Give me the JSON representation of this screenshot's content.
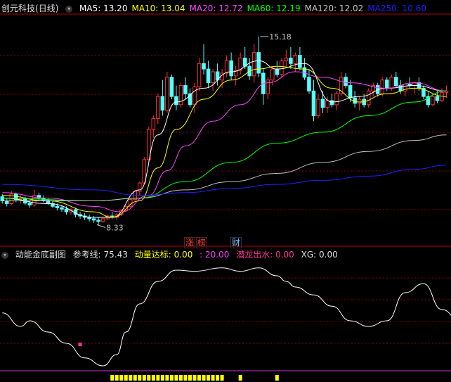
{
  "top_header": {
    "stock_name": "创元科技",
    "period": "(日线)",
    "ma_items": [
      {
        "label": "MA5:",
        "value": "13.20",
        "color": "#ffffff"
      },
      {
        "label": "MA10:",
        "value": "13.04",
        "color": "#ffff00"
      },
      {
        "label": "MA20:",
        "value": "12.72",
        "color": "#ff44ff"
      },
      {
        "label": "MA60:",
        "value": "12.19",
        "color": "#00ff00"
      },
      {
        "label": "MA120:",
        "value": "12.02",
        "color": "#c0c0c0"
      },
      {
        "label": "MA250:",
        "value": "10.60",
        "color": "#2020ff"
      }
    ]
  },
  "price_annotations": {
    "high": "15.18",
    "low": "8.33"
  },
  "event_tags": [
    "涨",
    "榜",
    "财"
  ],
  "bottom_header": {
    "indicator_name": "动能金底副图",
    "ref_label": "参考线:",
    "ref_value": "75.43",
    "signal_label": "动量达标:",
    "signal_value": "0.00",
    "signal_value2": ": 20.00",
    "dragon_label": "潜龙出水:",
    "dragon_value": "0.00",
    "xg_label": "XG:",
    "xg_value": "0.00"
  },
  "colors": {
    "up": "#ff3232",
    "down": "#54ffff",
    "grid": "#8b0000",
    "axis": "#b40000"
  },
  "chart_data": [
    {
      "type": "candlestick",
      "title": "创元科技 (日线)",
      "ylim": [
        7.6,
        16.0
      ],
      "candles": [
        [
          9.35,
          9.45,
          9.1,
          9.2
        ],
        [
          9.2,
          9.3,
          9.0,
          9.1
        ],
        [
          9.1,
          9.55,
          9.05,
          9.45
        ],
        [
          9.45,
          9.5,
          9.15,
          9.25
        ],
        [
          9.25,
          9.4,
          9.1,
          9.3
        ],
        [
          9.3,
          9.35,
          9.05,
          9.12
        ],
        [
          9.12,
          9.2,
          8.95,
          9.05
        ],
        [
          9.05,
          9.6,
          9.0,
          9.4
        ],
        [
          9.4,
          9.5,
          9.2,
          9.3
        ],
        [
          9.3,
          9.4,
          9.15,
          9.22
        ],
        [
          9.22,
          9.3,
          9.05,
          9.1
        ],
        [
          9.1,
          9.2,
          8.95,
          9.0
        ],
        [
          9.0,
          9.1,
          8.85,
          8.95
        ],
        [
          8.95,
          9.05,
          8.8,
          8.9
        ],
        [
          8.9,
          9.0,
          8.7,
          8.8
        ],
        [
          8.8,
          8.95,
          8.7,
          8.88
        ],
        [
          8.88,
          8.95,
          8.6,
          8.7
        ],
        [
          8.7,
          8.8,
          8.55,
          8.65
        ],
        [
          8.65,
          8.75,
          8.5,
          8.6
        ],
        [
          8.6,
          8.7,
          8.45,
          8.55
        ],
        [
          8.55,
          8.65,
          8.4,
          8.5
        ],
        [
          8.5,
          8.6,
          8.33,
          8.45
        ],
        [
          8.45,
          8.6,
          8.4,
          8.55
        ],
        [
          8.55,
          8.7,
          8.5,
          8.65
        ],
        [
          8.65,
          8.8,
          8.55,
          8.6
        ],
        [
          8.6,
          8.75,
          8.5,
          8.7
        ],
        [
          8.7,
          8.9,
          8.65,
          8.85
        ],
        [
          8.85,
          9.05,
          8.8,
          9.0
        ],
        [
          9.0,
          9.3,
          8.95,
          9.25
        ],
        [
          9.25,
          9.6,
          9.2,
          9.55
        ],
        [
          9.55,
          9.9,
          9.4,
          9.85
        ],
        [
          9.85,
          10.8,
          9.8,
          10.7
        ],
        [
          10.7,
          11.9,
          10.6,
          11.8
        ],
        [
          11.8,
          12.3,
          11.5,
          12.2
        ],
        [
          12.2,
          13.1,
          12.0,
          13.0
        ],
        [
          13.0,
          13.6,
          12.3,
          12.5
        ],
        [
          12.5,
          13.9,
          12.4,
          13.7
        ],
        [
          13.7,
          13.8,
          12.9,
          13.0
        ],
        [
          13.0,
          13.4,
          12.5,
          12.7
        ],
        [
          12.7,
          13.5,
          12.6,
          13.4
        ],
        [
          13.4,
          13.7,
          12.9,
          13.1
        ],
        [
          13.1,
          13.3,
          12.6,
          12.7
        ],
        [
          12.7,
          13.5,
          12.4,
          13.35
        ],
        [
          13.35,
          14.4,
          13.2,
          14.2
        ],
        [
          14.2,
          14.9,
          13.8,
          14.0
        ],
        [
          14.0,
          14.3,
          13.3,
          13.5
        ],
        [
          13.5,
          14.0,
          13.2,
          13.9
        ],
        [
          13.9,
          14.2,
          13.4,
          13.6
        ],
        [
          13.6,
          14.0,
          13.3,
          13.85
        ],
        [
          13.85,
          14.5,
          13.7,
          14.3
        ],
        [
          14.3,
          14.6,
          13.6,
          13.75
        ],
        [
          13.75,
          14.1,
          13.4,
          13.95
        ],
        [
          13.95,
          14.6,
          13.8,
          14.4
        ],
        [
          14.4,
          14.8,
          14.0,
          14.1
        ],
        [
          14.1,
          14.4,
          13.6,
          13.75
        ],
        [
          13.75,
          14.9,
          13.5,
          14.6
        ],
        [
          14.6,
          15.18,
          13.7,
          13.85
        ],
        [
          13.85,
          14.0,
          12.7,
          13.1
        ],
        [
          13.1,
          13.7,
          12.9,
          13.6
        ],
        [
          13.6,
          14.1,
          13.4,
          14.0
        ],
        [
          14.0,
          14.3,
          13.7,
          13.8
        ],
        [
          13.8,
          14.4,
          13.7,
          14.3
        ],
        [
          14.3,
          14.7,
          14.1,
          14.4
        ],
        [
          14.4,
          14.8,
          14.0,
          14.2
        ],
        [
          14.2,
          14.6,
          13.9,
          14.5
        ],
        [
          14.5,
          14.8,
          13.95,
          14.05
        ],
        [
          14.05,
          14.4,
          13.6,
          13.7
        ],
        [
          13.7,
          14.0,
          13.1,
          13.2
        ],
        [
          13.2,
          13.6,
          12.1,
          12.3
        ],
        [
          12.3,
          13.1,
          12.2,
          12.9
        ],
        [
          12.9,
          13.2,
          12.4,
          12.6
        ],
        [
          12.6,
          13.0,
          12.4,
          12.85
        ],
        [
          12.85,
          13.1,
          12.6,
          12.7
        ],
        [
          12.7,
          13.2,
          12.5,
          13.1
        ],
        [
          13.1,
          13.9,
          13.0,
          13.7
        ],
        [
          13.7,
          13.85,
          13.3,
          13.4
        ],
        [
          13.4,
          13.6,
          12.8,
          12.95
        ],
        [
          12.95,
          13.2,
          12.6,
          12.75
        ],
        [
          12.75,
          13.0,
          12.5,
          12.9
        ],
        [
          12.9,
          13.1,
          12.6,
          12.7
        ],
        [
          12.7,
          13.3,
          12.6,
          13.2
        ],
        [
          13.2,
          13.5,
          13.0,
          13.4
        ],
        [
          13.4,
          13.5,
          13.0,
          13.1
        ],
        [
          13.1,
          13.7,
          13.0,
          13.6
        ],
        [
          13.6,
          13.7,
          13.2,
          13.3
        ],
        [
          13.3,
          13.8,
          13.2,
          13.7
        ],
        [
          13.7,
          13.9,
          13.3,
          13.4
        ],
        [
          13.4,
          13.6,
          13.1,
          13.2
        ],
        [
          13.2,
          13.5,
          13.0,
          13.45
        ],
        [
          13.45,
          13.7,
          13.3,
          13.4
        ],
        [
          13.4,
          13.55,
          13.1,
          13.5
        ],
        [
          13.5,
          13.7,
          13.2,
          13.3
        ],
        [
          13.3,
          13.4,
          12.9,
          13.0
        ],
        [
          13.0,
          13.2,
          12.6,
          12.7
        ],
        [
          12.7,
          13.1,
          12.65,
          13.0
        ],
        [
          13.0,
          13.2,
          12.75,
          12.85
        ],
        [
          12.85,
          13.3,
          12.8,
          13.15
        ],
        [
          13.15,
          13.4,
          12.95,
          13.2
        ]
      ],
      "ma_series": [
        {
          "name": "MA5",
          "color": "#ffffff",
          "x": [
            0,
            10,
            20,
            24,
            30,
            34,
            38,
            44,
            50,
            56,
            60,
            66,
            72,
            78,
            84,
            90,
            97
          ],
          "values": [
            9.3,
            9.1,
            8.6,
            8.6,
            9.6,
            11.6,
            12.8,
            13.3,
            13.9,
            14.3,
            14.0,
            14.2,
            12.8,
            13.0,
            13.3,
            13.4,
            13.2
          ]
        },
        {
          "name": "MA10",
          "color": "#ffff00",
          "x": [
            0,
            10,
            20,
            24,
            30,
            34,
            38,
            44,
            50,
            56,
            60,
            66,
            72,
            78,
            84,
            90,
            97
          ],
          "values": [
            9.4,
            9.2,
            8.8,
            8.6,
            9.2,
            10.4,
            11.8,
            12.9,
            13.6,
            14.0,
            14.1,
            14.0,
            13.3,
            12.8,
            13.1,
            13.3,
            13.0
          ]
        },
        {
          "name": "MA20",
          "color": "#ff44ff",
          "x": [
            0,
            10,
            20,
            26,
            32,
            36,
            40,
            46,
            52,
            58,
            64,
            70,
            76,
            84,
            90,
            97
          ],
          "values": [
            9.5,
            9.3,
            9.0,
            8.8,
            9.4,
            10.3,
            11.2,
            12.1,
            12.7,
            13.5,
            13.9,
            13.7,
            13.5,
            13.3,
            13.5,
            13.2
          ]
        },
        {
          "name": "MA60",
          "color": "#00ff00",
          "x": [
            0,
            20,
            30,
            40,
            50,
            60,
            70,
            80,
            90,
            97
          ],
          "values": [
            9.3,
            9.2,
            9.3,
            9.9,
            10.6,
            11.3,
            11.7,
            12.3,
            12.8,
            13.2
          ]
        },
        {
          "name": "MA120",
          "color": "#c0c0c0",
          "x": [
            0,
            20,
            30,
            40,
            50,
            60,
            70,
            80,
            90,
            97
          ],
          "values": [
            9.2,
            9.2,
            9.3,
            9.6,
            9.9,
            10.2,
            10.6,
            11.0,
            11.4,
            11.6
          ]
        },
        {
          "name": "MA250",
          "color": "#2020ff",
          "x": [
            0,
            20,
            30,
            40,
            50,
            60,
            70,
            80,
            90,
            97
          ],
          "values": [
            9.8,
            9.6,
            9.4,
            9.5,
            9.65,
            9.8,
            9.95,
            10.1,
            10.35,
            10.5
          ]
        }
      ]
    },
    {
      "type": "line",
      "title": "动能金底副图",
      "ylim": [
        0,
        100
      ],
      "series": [
        {
          "name": "参考线",
          "color": "#ffffff",
          "x": [
            0,
            4,
            6,
            10,
            14,
            18,
            22,
            25,
            27,
            30,
            34,
            38,
            42,
            48,
            52,
            56,
            60,
            62,
            64,
            68,
            72,
            76,
            80,
            84,
            88,
            92,
            96,
            100
          ],
          "values": [
            52,
            40,
            45,
            35,
            25,
            12,
            5,
            15,
            35,
            60,
            80,
            90,
            89,
            92,
            89,
            92,
            85,
            80,
            75,
            68,
            58,
            45,
            40,
            45,
            70,
            78,
            55,
            45
          ]
        },
        {
          "name": "动量达标",
          "color": "#ffff00",
          "bars_x": [
            24,
            25,
            26,
            27,
            28,
            29,
            30,
            31,
            32,
            33,
            34,
            35,
            36,
            37,
            38,
            39,
            40,
            41,
            42,
            43,
            44,
            45,
            46,
            47,
            48,
            52,
            60
          ]
        }
      ],
      "marker": {
        "x": 17,
        "value": 24,
        "color": "#ff3399"
      }
    }
  ]
}
